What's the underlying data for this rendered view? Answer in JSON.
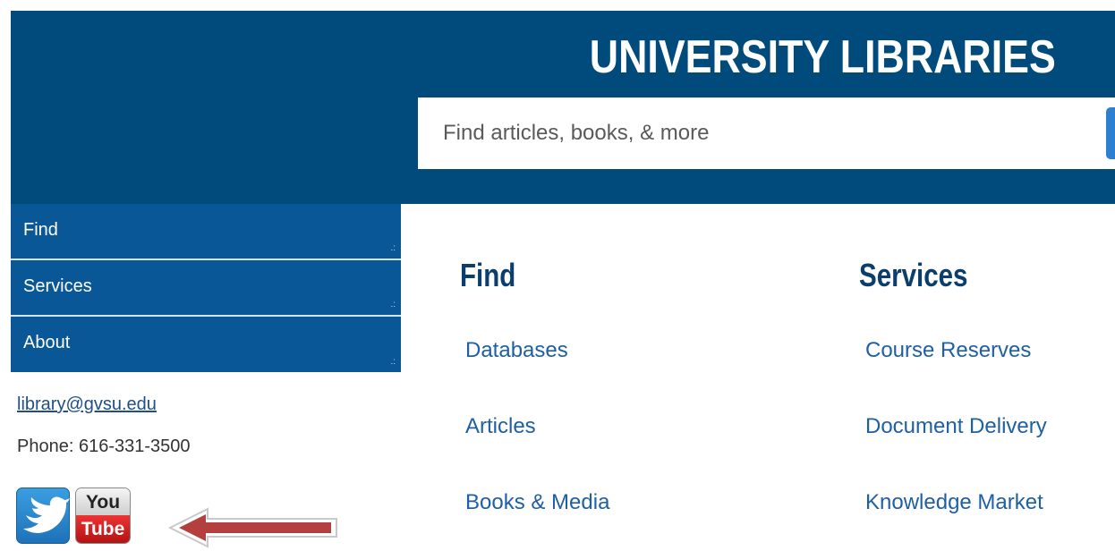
{
  "header": {
    "title": "UNIVERSITY LIBRARIES",
    "search_placeholder": "Find articles, books, & more"
  },
  "nav": {
    "items": [
      {
        "label": "Find"
      },
      {
        "label": "Services"
      },
      {
        "label": "About"
      }
    ]
  },
  "contact": {
    "email": "library@gvsu.edu",
    "phone": "Phone: 616-331-3500"
  },
  "social": {
    "youtube_top": "You",
    "youtube_bottom": "Tube",
    "icons": [
      "twitter-icon",
      "youtube-icon"
    ]
  },
  "main": {
    "columns": [
      {
        "heading": "Find",
        "links": [
          "Databases",
          "Articles",
          "Books & Media"
        ]
      },
      {
        "heading": "Services",
        "links": [
          "Course Reserves",
          "Document Delivery",
          "Knowledge Market"
        ]
      }
    ]
  },
  "colors": {
    "header_bg": "#004a7c",
    "nav_bg": "#0a5797",
    "link": "#1e5fa6",
    "heading": "#0a3e6c",
    "arrow": "#b3403f"
  }
}
